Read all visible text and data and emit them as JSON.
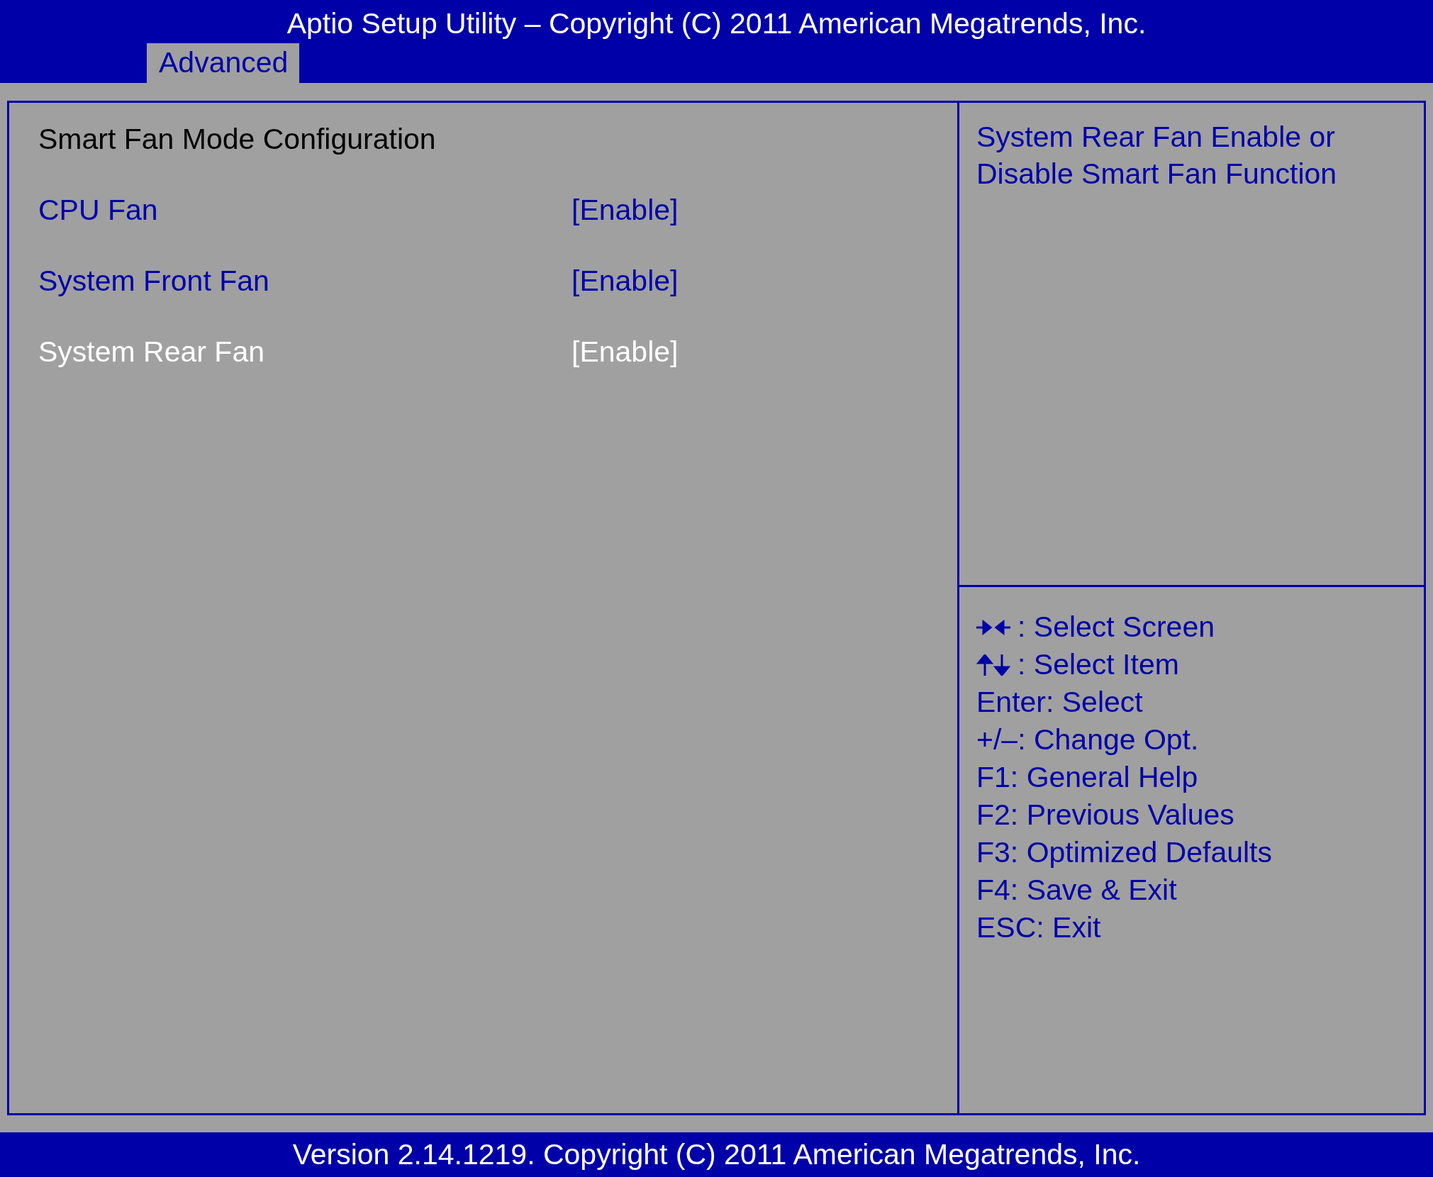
{
  "window": {
    "title": "Aptio Setup Utility – Copyright (C) 2011 American Megatrends, Inc."
  },
  "tabs": [
    {
      "label": "Advanced",
      "selected": true
    }
  ],
  "section_title": "Smart Fan Mode Configuration",
  "settings": [
    {
      "name": "CPU Fan",
      "value": "[Enable]",
      "selected": false
    },
    {
      "name": "System Front Fan",
      "value": "[Enable]",
      "selected": false
    },
    {
      "name": "System Rear Fan",
      "value": "[Enable]",
      "selected": true
    }
  ],
  "help_text": "System Rear Fan Enable or Disable Smart Fan Function",
  "key_legend": [
    {
      "kind": "arrows-horizontal",
      "text": ": Select Screen"
    },
    {
      "kind": "arrows-vertical",
      "text": ": Select Item"
    },
    {
      "kind": "text",
      "text": "Enter: Select"
    },
    {
      "kind": "text",
      "text": "+/–: Change Opt."
    },
    {
      "kind": "text",
      "text": "F1: General Help"
    },
    {
      "kind": "text",
      "text": "F2: Previous Values"
    },
    {
      "kind": "text",
      "text": "F3: Optimized Defaults"
    },
    {
      "kind": "text",
      "text": "F4: Save & Exit"
    },
    {
      "kind": "text",
      "text": "ESC: Exit"
    }
  ],
  "status_bar": "Version 2.14.1219. Copyright (C) 2011 American Megatrends, Inc."
}
